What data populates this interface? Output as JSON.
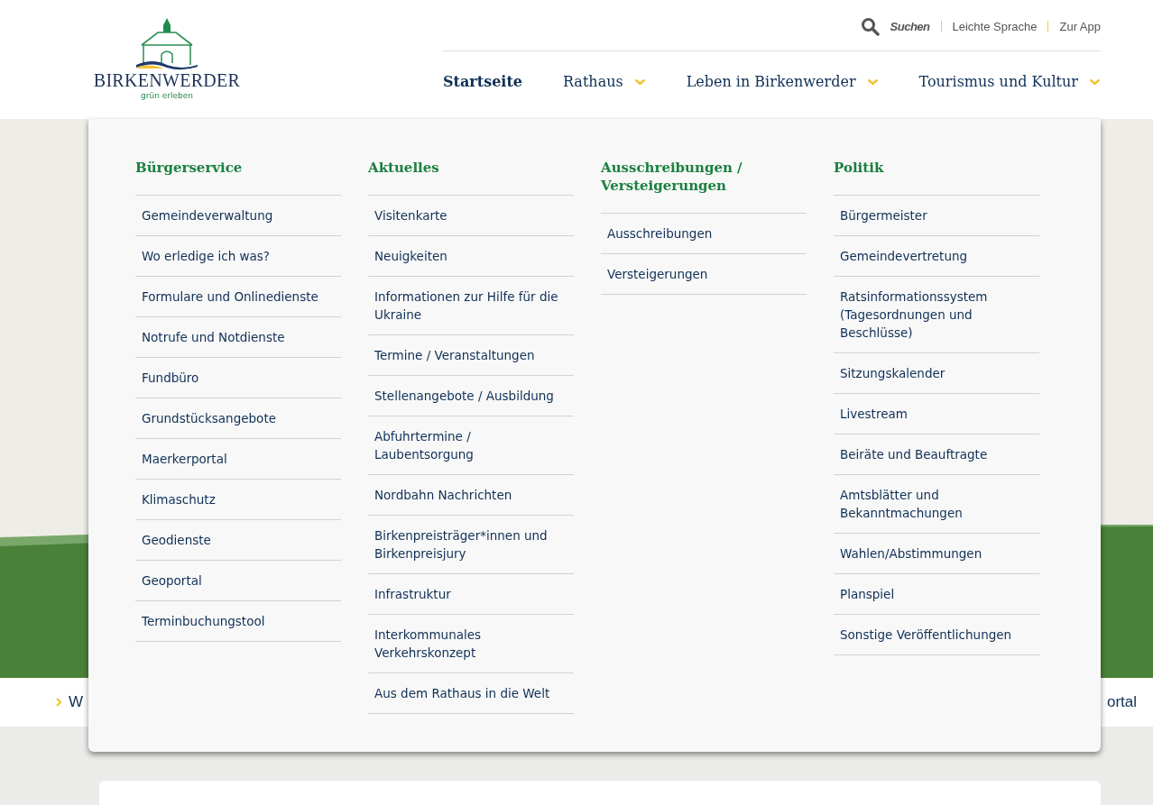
{
  "logo": {
    "name": "BIRKENWERDER",
    "tagline": "grün erleben"
  },
  "utility_links": [
    {
      "label": "Suchen",
      "kind": "search"
    },
    {
      "label": "Leichte Sprache",
      "kind": "link"
    },
    {
      "label": "Zur App",
      "kind": "link"
    }
  ],
  "main_nav": [
    {
      "label": "Startseite",
      "selected": true,
      "has_submenu": false
    },
    {
      "label": "Rathaus",
      "selected": false,
      "has_submenu": true
    },
    {
      "label": "Leben in Birkenwerder",
      "selected": false,
      "has_submenu": true
    },
    {
      "label": "Tourismus und Kultur",
      "selected": false,
      "has_submenu": true
    }
  ],
  "mega_menu": {
    "columns": [
      {
        "heading": "Bürgerservice",
        "items": [
          "Gemeindeverwaltung",
          "Wo erledige ich was?",
          "Formulare und Onlinedienste",
          "Notrufe und Notdienste",
          "Fundbüro",
          "Grundstücksangebote",
          "Maerkerportal",
          "Klimaschutz",
          "Geodienste",
          "Geoportal",
          "Terminbuchungstool"
        ]
      },
      {
        "heading": "Aktuelles",
        "items": [
          "Visitenkarte",
          "Neuigkeiten",
          "Informationen zur Hilfe für die Ukraine",
          "Termine / Veranstaltungen",
          "Stellenangebote / Ausbildung",
          "Abfuhrtermine / Laubentsorgung",
          "Nordbahn Nachrichten",
          "Birkenpreisträger*innen und Birkenpreisjury",
          "Infrastruktur",
          "Interkommunales Verkehrskonzept",
          "Aus dem Rathaus in die Welt"
        ]
      },
      {
        "heading": "Ausschreibungen / Versteigerungen",
        "items": [
          "Ausschreibungen",
          "Versteigerungen"
        ]
      },
      {
        "heading": "Politik",
        "items": [
          "Bürgermeister",
          "Gemeindevertretung",
          "Ratsinformationssystem (Tagesordnungen und Beschlüsse)",
          "Sitzungskalender",
          "Livestream",
          "Beiräte und Beauftragte",
          "Amtsblätter und Bekanntmachungen",
          "Wahlen/Abstimmungen",
          "Planspiel",
          "Sonstige Veröffentlichungen"
        ]
      }
    ]
  },
  "quick_links": [
    "W",
    "ortal"
  ]
}
